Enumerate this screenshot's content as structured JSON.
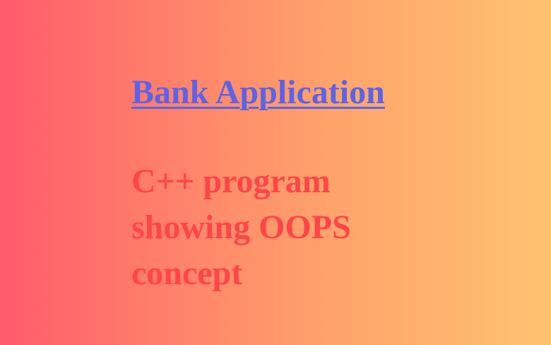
{
  "title": "Bank Application",
  "subtitle": "C++ program showing OOPS concept",
  "colors": {
    "gradient_start": "#ff5b6d",
    "gradient_end": "#ffc371",
    "title": "#5a63ea",
    "subtitle": "#ff4548"
  }
}
